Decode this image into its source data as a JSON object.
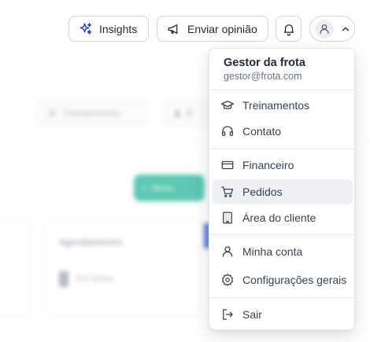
{
  "topbar": {
    "insights_label": "Insights",
    "feedback_label": "Enviar opinião"
  },
  "background": {
    "ghost_tab_1": "Treinamentos",
    "ghost_tab_2": "B",
    "primary_button": "Novo",
    "card_title": "Agendamentos",
    "card_row": "Em breve",
    "accent_color": "#26b59a"
  },
  "dropdown": {
    "user_name": "Gestor da frota",
    "user_email": "gestor@frota.com",
    "items": [
      {
        "label": "Treinamentos",
        "icon": "graduation-cap-icon"
      },
      {
        "label": "Contato",
        "icon": "headset-icon"
      },
      {
        "label": "Financeiro",
        "icon": "credit-card-icon"
      },
      {
        "label": "Pedidos",
        "icon": "shopping-cart-icon",
        "active": true
      },
      {
        "label": "Área do cliente",
        "icon": "building-icon"
      },
      {
        "label": "Minha conta",
        "icon": "user-icon"
      },
      {
        "label": "Configurações gerais",
        "icon": "settings-icon"
      },
      {
        "label": "Sair",
        "icon": "logout-icon"
      }
    ]
  }
}
